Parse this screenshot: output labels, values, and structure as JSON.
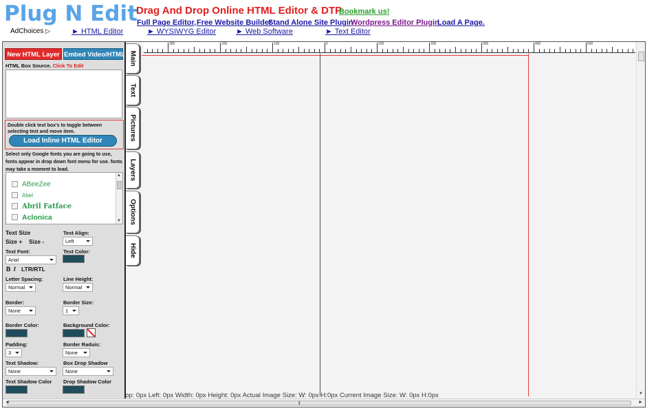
{
  "header": {
    "logo": "Plug N Edit",
    "adchoices": "AdChoices",
    "headline": "Drag And Drop Online HTML Editor & DTP",
    "bookmark": "Bookmark us!",
    "top_links": [
      {
        "label": "Full Page Editor,",
        "color": "#1a1aa6"
      },
      {
        "label": "Free Website Builder",
        "color": "#1a1aa6"
      },
      {
        "label": "Stand Alone Site Plugin",
        "color": "#1a1aa6"
      },
      {
        "label": "Wordpress Editor Plugin",
        "color": "#7a1a8a"
      },
      {
        "label": "Load A Page.",
        "color": "#1a1aa6"
      }
    ],
    "nav_links": [
      "► HTML Editor",
      "► WYSIWYG Editor",
      "► Web Software",
      "► Text Editor"
    ]
  },
  "panel": {
    "new_layer_button": "New HTML Layer",
    "embed_button": "Embed Video/HTML",
    "source_label": "HTML Box Source.",
    "source_click": "Click To Edit",
    "source_value": "",
    "toggle_hint": "Double click text box's to toggle between selecting text and move item.",
    "inline_editor_button": "Load Inline HTML Editor",
    "google_fonts_note": "Select only Google fonts you are going to use, fonts appear in drop down font menu for use. fonts may take a moment to load.",
    "fonts": [
      "ABeeZee",
      "Abel",
      "Abril Fatface",
      "Aclonica"
    ],
    "text_size_label": "Text Size",
    "size_plus": "Size +",
    "size_minus": "Size -",
    "text_align_label": "Text Align:",
    "text_align_value": "Left",
    "text_font_label": "Text Font:",
    "text_font_value": "Arial",
    "text_color_label": "Text Color:",
    "bold": "B",
    "italic": "I",
    "direction": "LTR/RTL",
    "letter_spacing_label": "Letter Spacing:",
    "letter_spacing_value": "Normal",
    "line_height_label": "Line Height:",
    "line_height_value": "Normal",
    "border_label": "Border:",
    "border_value": "None",
    "border_size_label": "Border Size:",
    "border_size_value": "1",
    "border_color_label": "Border Color:",
    "background_color_label": "Background Color:",
    "padding_label": "Padding:",
    "padding_value": "3",
    "border_radius_label": "Border Raduis:",
    "border_radius_value": "None",
    "text_shadow_label": "Text Shadow:",
    "text_shadow_value": "None",
    "box_shadow_label": "Box Drop Shadow",
    "box_shadow_value": "None",
    "text_shadow_color_label": "Text Shadow Color",
    "drop_shadow_color_label": "Drop Shadow Color",
    "swatch_color": "#1f4d5c"
  },
  "tabs": [
    "Main",
    "Text",
    "Pictures",
    "Layers",
    "Options",
    "Hide"
  ],
  "ruler": {
    "labels": [
      "300",
      "200",
      "100",
      "0",
      "100",
      "200",
      "300",
      "400",
      "500"
    ]
  },
  "status": "op: 0px   Left: 0px   Width: 0px    Height: 0px    Actual Image Size: W: 0px H:0px    Current Image Size: W: 0px H:0px",
  "colors": {
    "logo": "#5aa4e6",
    "accent_red": "#e12b2b",
    "accent_blue": "#2f86b8",
    "font_list_green": "#2a9a4a"
  }
}
